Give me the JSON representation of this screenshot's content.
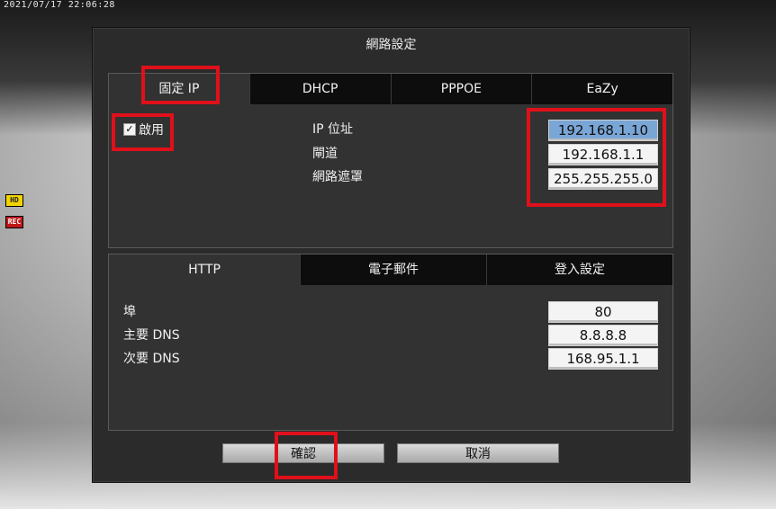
{
  "osd": {
    "timestamp": "2021/07/17 22:06:28",
    "hd_badge": "HD",
    "rec_badge": "REC"
  },
  "dialog": {
    "title": "網路設定"
  },
  "network": {
    "tabs": [
      "固定 IP",
      "DHCP",
      "PPPOE",
      "EaZy"
    ],
    "active_tab": "固定 IP",
    "enable_label": "啟用",
    "enable_checked": true,
    "fields": [
      {
        "label": "IP 位址",
        "value": "192.168.1.10"
      },
      {
        "label": "閘道",
        "value": "192.168.1.1"
      },
      {
        "label": "網路遮罩",
        "value": "255.255.255.0"
      }
    ]
  },
  "services": {
    "tabs": [
      "HTTP",
      "電子郵件",
      "登入設定"
    ],
    "active_tab": "HTTP",
    "fields": [
      {
        "label": "埠",
        "value": "80"
      },
      {
        "label": "主要 DNS",
        "value": "8.8.8.8"
      },
      {
        "label": "次要 DNS",
        "value": "168.95.1.1"
      }
    ]
  },
  "buttons": {
    "ok": "確認",
    "cancel": "取消"
  },
  "colors": {
    "highlight": "#e0101a",
    "focused_field": "#7aa6d6",
    "panel_bg": "#323232",
    "tab_bg": "#0d0d0d"
  }
}
